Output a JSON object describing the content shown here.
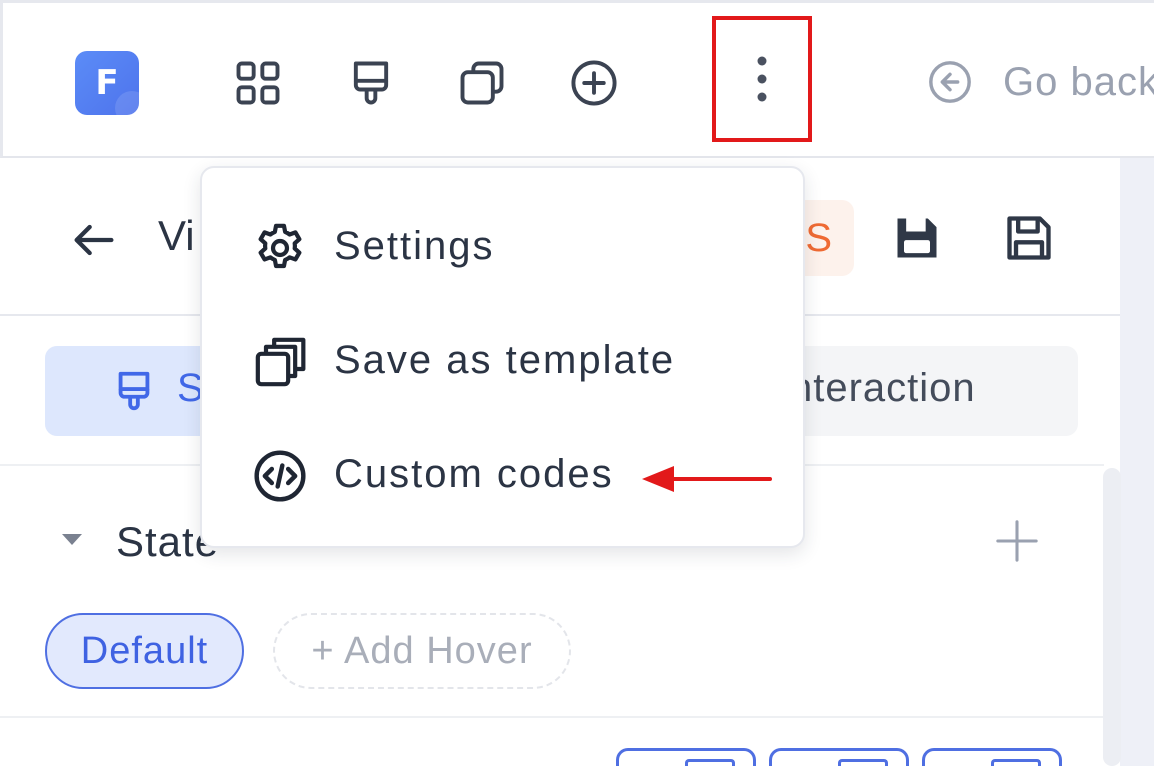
{
  "toolbar": {
    "logo_letter": "F",
    "icons": [
      "grid-icon",
      "brush-icon",
      "layers-icon",
      "plus-circle-icon",
      "more-vertical-icon"
    ],
    "go_back_label": "Go back"
  },
  "panel": {
    "title_visible": "Vi",
    "badge_visible": "S",
    "tabs": {
      "style_visible": "S",
      "interaction_visible": "nteraction"
    },
    "state_section": {
      "title": "State",
      "default_chip": "Default",
      "add_hover_chip": "+ Add Hover"
    }
  },
  "menu": {
    "items": [
      {
        "label": "Settings",
        "icon": "gear-icon"
      },
      {
        "label": "Save as template",
        "icon": "copy-stack-icon"
      },
      {
        "label": "Custom codes",
        "icon": "code-circle-icon"
      }
    ]
  },
  "colors": {
    "accent": "#4f6fe2",
    "highlight_box": "#e2191a",
    "badge_text": "#ef6a33"
  }
}
